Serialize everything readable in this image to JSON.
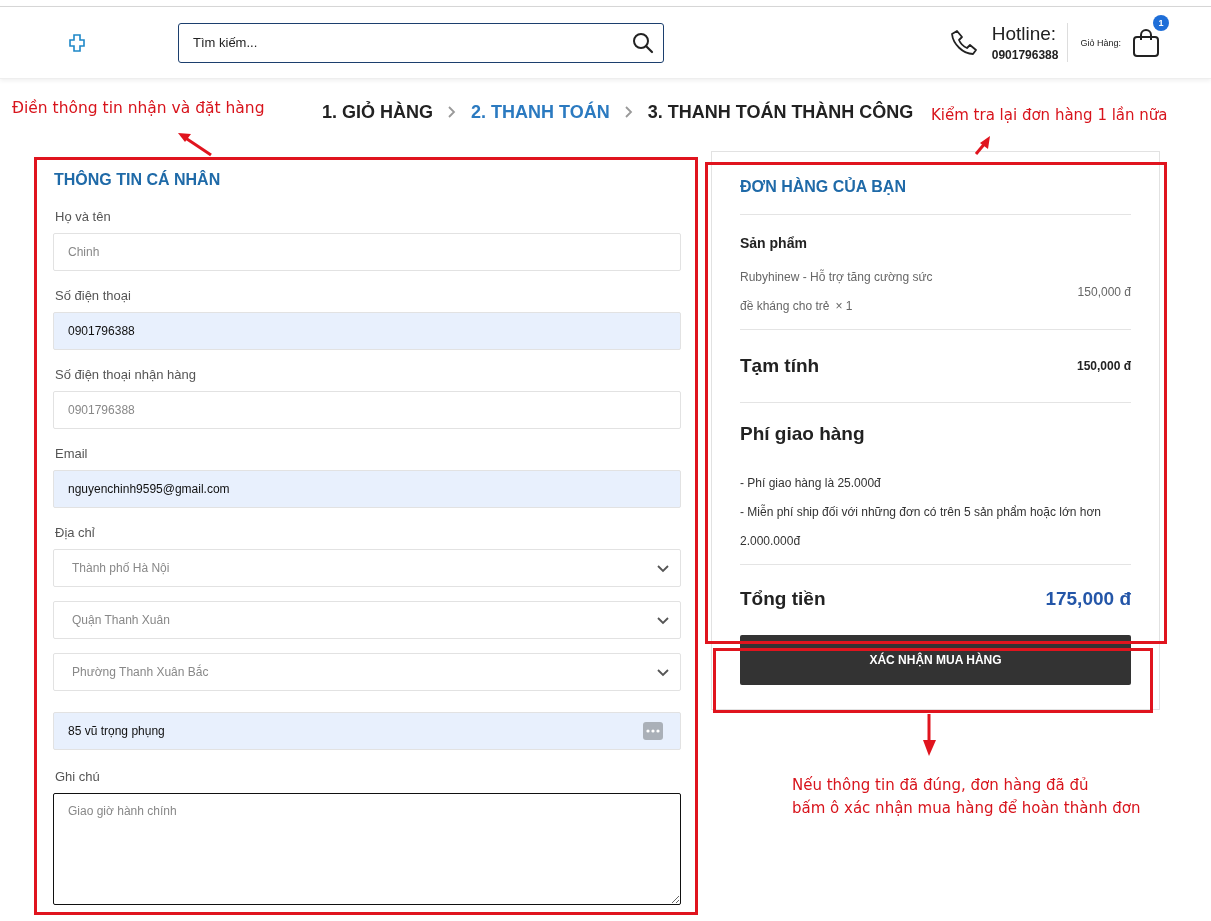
{
  "header": {
    "search": {
      "placeholder": "Tìm kiếm..."
    },
    "hotline_label": "Hotline:",
    "hotline_number": "0901796388",
    "cart_label": "Giỏ Hàng:",
    "cart_count": "1"
  },
  "steps": [
    {
      "label": "1. GIỎ HÀNG",
      "selected": false
    },
    {
      "label": "2. THANH TOÁN",
      "selected": true
    },
    {
      "label": "3. THANH TOÁN THÀNH CÔNG",
      "selected": false
    }
  ],
  "form": {
    "title": "THÔNG TIN CÁ NHÂN",
    "fields": [
      {
        "kind": "text",
        "label": "Họ và tên",
        "placeholder": "Chinh",
        "autofilled": false
      },
      {
        "kind": "text",
        "label": "Số điện thoại",
        "value": "0901796388",
        "autofilled": true
      },
      {
        "kind": "text",
        "label": "Số điện thoại nhận hàng",
        "placeholder": "0901796388",
        "autofilled": false
      },
      {
        "kind": "text",
        "label": "Email",
        "value": "nguyenchinh9595@gmail.com",
        "autofilled": true
      },
      {
        "kind": "select",
        "label": "Địa chỉ",
        "value": "Thành phố Hà Nội"
      },
      {
        "kind": "select",
        "value": "Quận Thanh Xuân"
      },
      {
        "kind": "select",
        "value": "Phường Thanh Xuân Bắc"
      },
      {
        "kind": "text",
        "value": "85 vũ trọng phụng",
        "autofilled": true,
        "autofill_icon": true
      },
      {
        "kind": "textarea",
        "label": "Ghi chú",
        "placeholder": "Giao giờ hành chính",
        "focused": true
      }
    ]
  },
  "order": {
    "title": "ĐƠN HÀNG CỦA BẠN",
    "product_heading": "Sản phẩm",
    "product": {
      "name": "Rubyhinew - Hỗ trợ tăng cường sức đề kháng cho trẻ",
      "quantity": "× 1",
      "price": "150,000 đ"
    },
    "subtotal": {
      "label": "Tạm tính",
      "value": "150,000 đ"
    },
    "shipping": {
      "title": "Phí giao hàng",
      "notes": [
        "- Phí giao hàng là 25.000đ",
        "- Miễn phí ship đối với những đơn có trên 5 sản phẩm hoặc lớn hơn 2.000.000đ"
      ]
    },
    "total": {
      "label": "Tổng tiền",
      "value": "175,000 đ"
    },
    "confirm_button": "XÁC NHẬN MUA HÀNG"
  },
  "annotations": [
    {
      "kind": "left",
      "text": "Điền thông tin nhận và đặt hàng"
    },
    {
      "kind": "right",
      "text": "Kiểm tra lại đơn hàng 1 lần nữa"
    },
    {
      "kind": "bottom",
      "lines": [
        "Nếu thông tin đã đúng, đơn hàng đã đủ",
        "bấm ô xác nhận mua hàng để hoàn thành đơn"
      ]
    }
  ]
}
